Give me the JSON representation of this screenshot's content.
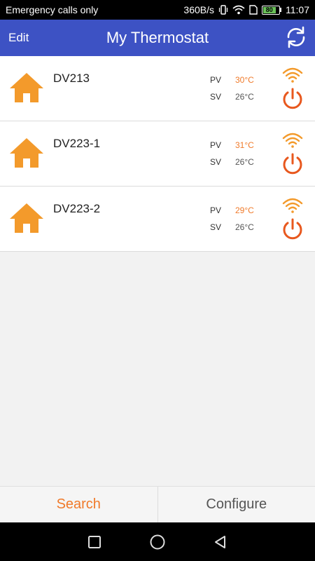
{
  "status_bar": {
    "carrier_text": "Emergency calls only",
    "net_speed": "360B/s",
    "battery_level": "80",
    "time": "11:07"
  },
  "app_bar": {
    "edit_label": "Edit",
    "title": "My Thermostat",
    "refresh_icon": "refresh-icon"
  },
  "devices": [
    {
      "name": "DV213",
      "pv_label": "PV",
      "pv_value": "30°C",
      "sv_label": "SV",
      "sv_value": "26°C"
    },
    {
      "name": "DV223-1",
      "pv_label": "PV",
      "pv_value": "31°C",
      "sv_label": "SV",
      "sv_value": "26°C"
    },
    {
      "name": "DV223-2",
      "pv_label": "PV",
      "pv_value": "29°C",
      "sv_label": "SV",
      "sv_value": "26°C"
    }
  ],
  "tabs": {
    "search_label": "Search",
    "configure_label": "Configure"
  },
  "colors": {
    "app_bar": "#3d52c4",
    "accent_orange": "#f07a2a",
    "house_orange": "#f39a2b"
  }
}
